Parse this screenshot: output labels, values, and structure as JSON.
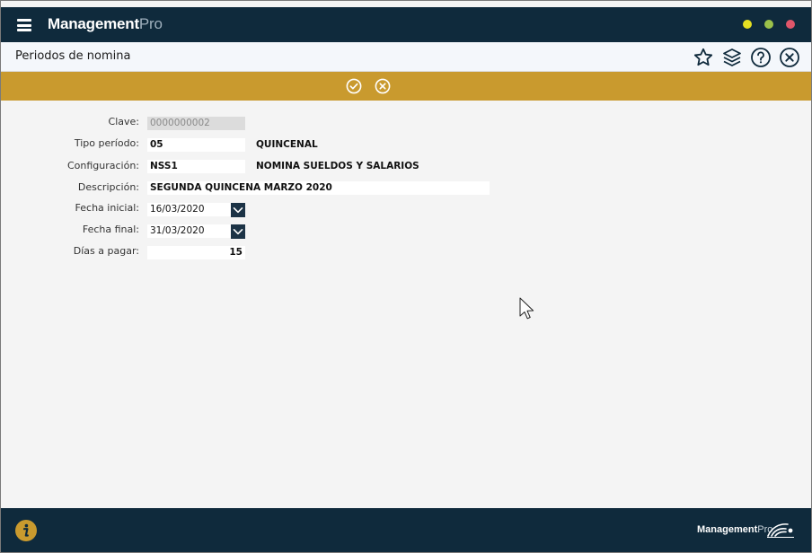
{
  "app": {
    "brand_bold": "Management",
    "brand_light": "Pro",
    "footer_brand_bold": "Management",
    "footer_brand_light": "Pro"
  },
  "header": {
    "title": "Periodos de nomina"
  },
  "form": {
    "clave": {
      "label": "Clave:",
      "value": "0000000002"
    },
    "tipo_periodo": {
      "label": "Tipo período:",
      "value": "05",
      "description": "QUINCENAL"
    },
    "configuracion": {
      "label": "Configuración:",
      "value": "NSS1",
      "description": "NOMINA SUELDOS Y SALARIOS"
    },
    "descripcion": {
      "label": "Descripción:",
      "value": "SEGUNDA QUINCENA MARZO 2020"
    },
    "fecha_inicial": {
      "label": "Fecha inicial:",
      "value": "16/03/2020"
    },
    "fecha_final": {
      "label": "Fecha final:",
      "value": "31/03/2020"
    },
    "dias_a_pagar": {
      "label": "Días a pagar:",
      "value": "15"
    }
  },
  "colors": {
    "titlebar": "#0f2a3c",
    "accent_gold": "#c99a2e",
    "window_yellow": "#e5e022",
    "window_green": "#9bc14a",
    "window_red": "#e0566a"
  },
  "icons": {
    "menu": "hamburger-icon",
    "favorite": "star-icon",
    "layers": "layers-icon",
    "help": "help-icon",
    "close": "close-circle-icon",
    "accept": "check-circle-icon",
    "cancel": "cancel-circle-icon",
    "dropdown": "chevron-down-icon",
    "info": "info-icon"
  }
}
